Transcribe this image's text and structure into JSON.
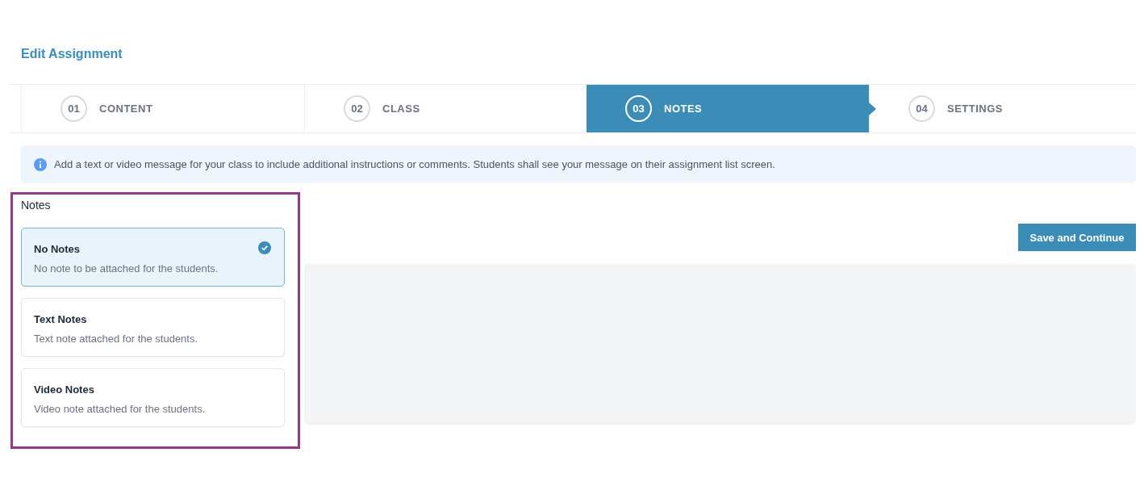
{
  "page_title": "Edit Assignment",
  "steps": [
    {
      "number": "01",
      "label": "CONTENT",
      "selected": false
    },
    {
      "number": "02",
      "label": "CLASS",
      "selected": false
    },
    {
      "number": "03",
      "label": "NOTES",
      "selected": true
    },
    {
      "number": "04",
      "label": "SETTINGS",
      "selected": false
    }
  ],
  "info_message": "Add a text or video message for your class to include additional instructions or comments. Students shall see your message on their assignment list screen.",
  "notes": {
    "heading": "Notes",
    "options": [
      {
        "title": "No Notes",
        "description": "No note to be attached for the students.",
        "selected": true
      },
      {
        "title": "Text Notes",
        "description": "Text note attached for the students.",
        "selected": false
      },
      {
        "title": "Video Notes",
        "description": "Video note attached for the students.",
        "selected": false
      }
    ]
  },
  "save_button": "Save and Continue"
}
